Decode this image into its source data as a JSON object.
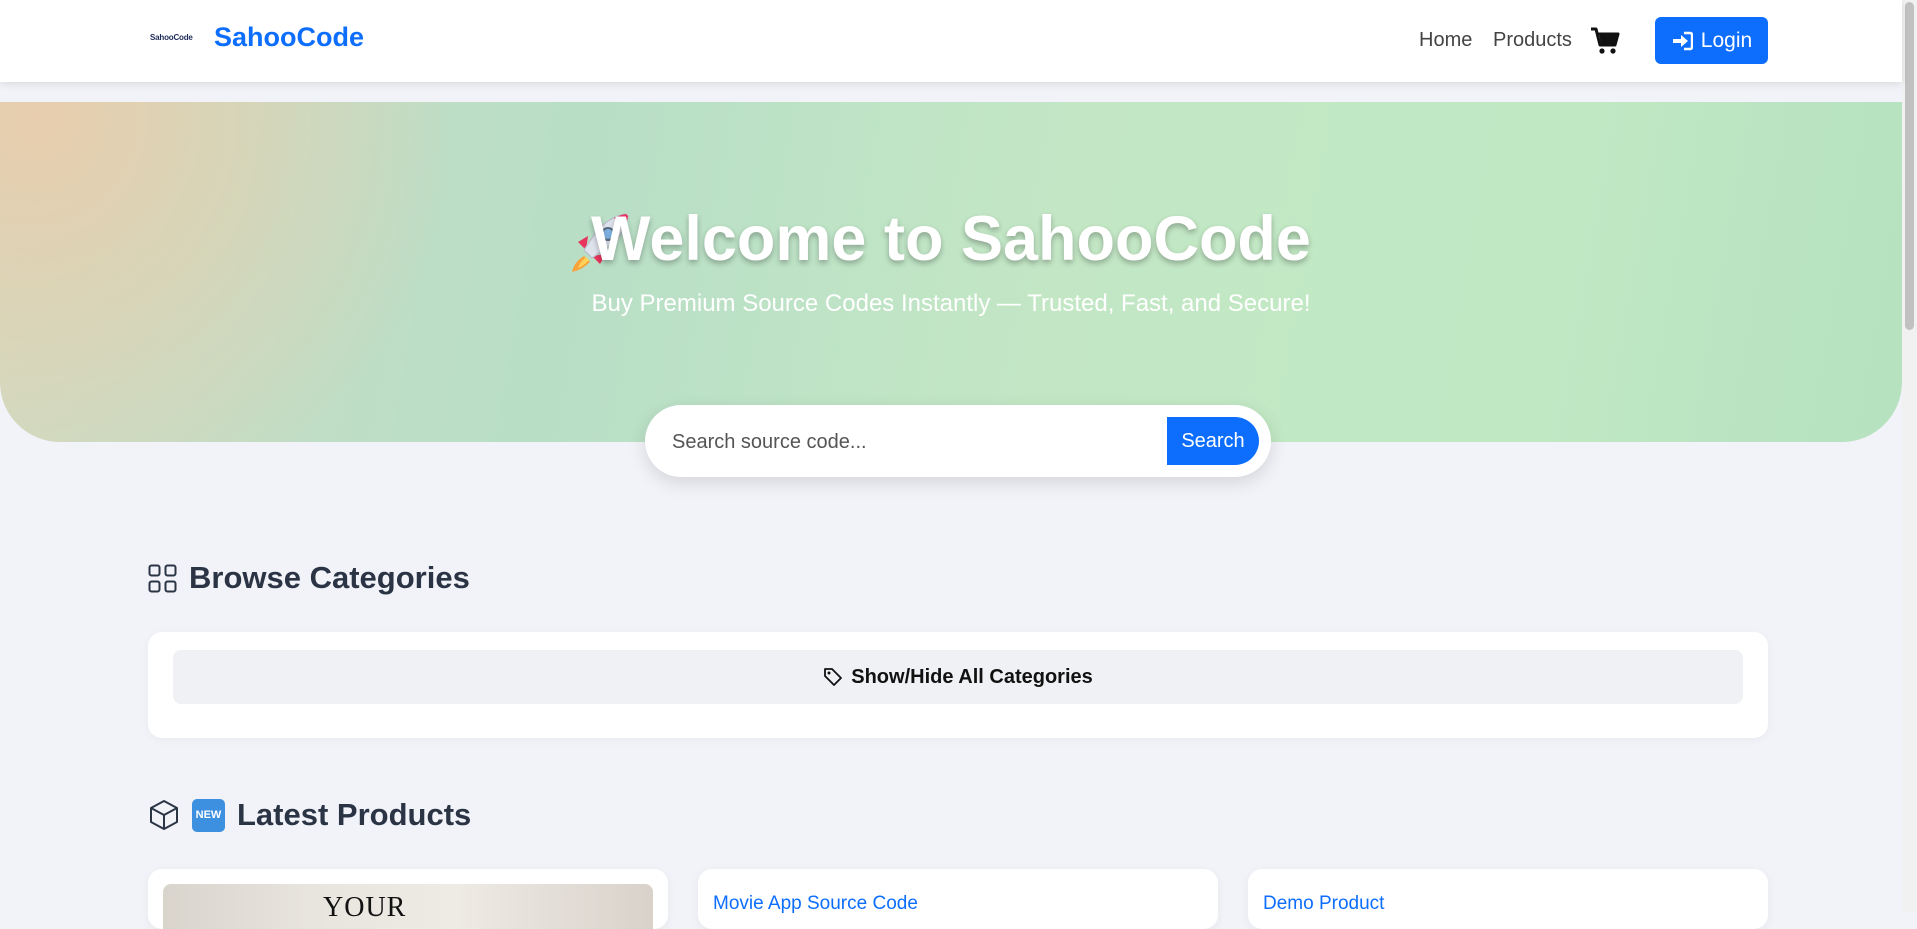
{
  "navbar": {
    "logo_text": "SahooCode",
    "brand": "SahooCode",
    "links": [
      {
        "label": "Home"
      },
      {
        "label": "Products"
      }
    ],
    "login_label": "Login"
  },
  "hero": {
    "title": "Welcome to SahooCode",
    "subtitle": "Buy Premium Source Codes Instantly — Trusted, Fast, and Secure!"
  },
  "search": {
    "placeholder": "Search source code...",
    "button_label": "Search"
  },
  "categories": {
    "heading": "Browse Categories",
    "toggle_label": "Show/Hide All Categories"
  },
  "products": {
    "heading": "Latest Products",
    "badge": "NEW",
    "items": [
      {
        "title": "",
        "thumb_text": "YOUR"
      },
      {
        "title": "Movie App Source Code"
      },
      {
        "title": "Demo Product"
      }
    ]
  },
  "icons": {
    "rocket": "rocket-icon",
    "cart": "cart-icon",
    "login": "sign-in-icon",
    "grid": "grid-icon",
    "tag": "tag-icon",
    "box": "box-icon"
  },
  "colors": {
    "accent": "#0d6efd",
    "heading": "#2b3445",
    "hero_green": "#c0e8c3"
  }
}
